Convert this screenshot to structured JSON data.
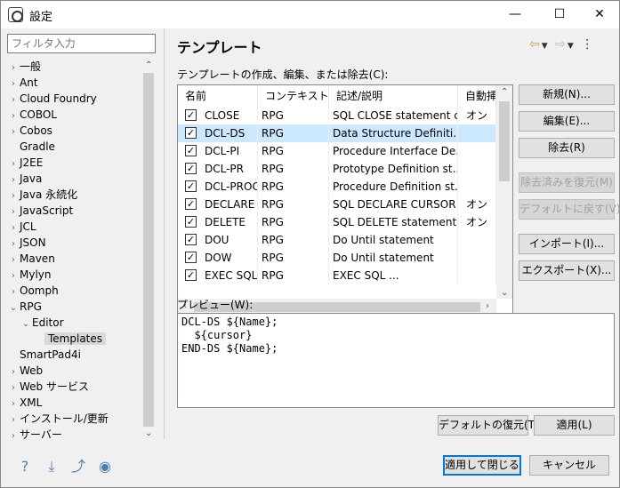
{
  "window": {
    "title": "設定",
    "minimize": "—",
    "maximize": "☐",
    "close": "✕"
  },
  "filter": {
    "placeholder": "フィルタ入力"
  },
  "tree": [
    {
      "label": "一般",
      "arrow": "›",
      "level": 0
    },
    {
      "label": "Ant",
      "arrow": "›",
      "level": 0
    },
    {
      "label": "Cloud Foundry",
      "arrow": "›",
      "level": 0
    },
    {
      "label": "COBOL",
      "arrow": "›",
      "level": 0
    },
    {
      "label": "Cobos",
      "arrow": "›",
      "level": 0
    },
    {
      "label": "Gradle",
      "arrow": "",
      "level": 0
    },
    {
      "label": "J2EE",
      "arrow": "›",
      "level": 0
    },
    {
      "label": "Java",
      "arrow": "›",
      "level": 0
    },
    {
      "label": "Java 永続化",
      "arrow": "›",
      "level": 0
    },
    {
      "label": "JavaScript",
      "arrow": "›",
      "level": 0
    },
    {
      "label": "JCL",
      "arrow": "›",
      "level": 0
    },
    {
      "label": "JSON",
      "arrow": "›",
      "level": 0
    },
    {
      "label": "Maven",
      "arrow": "›",
      "level": 0
    },
    {
      "label": "Mylyn",
      "arrow": "›",
      "level": 0
    },
    {
      "label": "Oomph",
      "arrow": "›",
      "level": 0
    },
    {
      "label": "RPG",
      "arrow": "⌄",
      "level": 0
    },
    {
      "label": "Editor",
      "arrow": "⌄",
      "level": 1
    },
    {
      "label": "Templates",
      "arrow": "",
      "level": 2,
      "selected": true
    },
    {
      "label": "SmartPad4i",
      "arrow": "",
      "level": 0
    },
    {
      "label": "Web",
      "arrow": "›",
      "level": 0
    },
    {
      "label": "Web サービス",
      "arrow": "›",
      "level": 0
    },
    {
      "label": "XML",
      "arrow": "›",
      "level": 0
    },
    {
      "label": "インストール/更新",
      "arrow": "›",
      "level": 0
    },
    {
      "label": "サーバー",
      "arrow": "›",
      "level": 0
    }
  ],
  "page": {
    "title": "テンプレート",
    "table_label": "テンプレートの作成、編集、または除去(C):",
    "preview_label": "プレビュー(W):",
    "columns": [
      "名前",
      "コンテキスト",
      "記述/説明",
      "自動挿"
    ],
    "rows": [
      {
        "name": "CLOSE",
        "context": "RPG",
        "desc": "SQL CLOSE statement c...",
        "auto": "オン",
        "checked": true
      },
      {
        "name": "DCL-DS",
        "context": "RPG",
        "desc": "Data Structure Definiti...",
        "auto": "",
        "checked": true,
        "selected": true
      },
      {
        "name": "DCL-PI",
        "context": "RPG",
        "desc": "Procedure Interface De...",
        "auto": "",
        "checked": true
      },
      {
        "name": "DCL-PR",
        "context": "RPG",
        "desc": "Prototype Definition st...",
        "auto": "",
        "checked": true
      },
      {
        "name": "DCL-PROC",
        "context": "RPG",
        "desc": "Procedure Definition st...",
        "auto": "",
        "checked": true
      },
      {
        "name": "DECLARE",
        "context": "RPG",
        "desc": "SQL DECLARE CURSOR ...",
        "auto": "オン",
        "checked": true
      },
      {
        "name": "DELETE",
        "context": "RPG",
        "desc": "SQL DELETE statement ...",
        "auto": "オン",
        "checked": true
      },
      {
        "name": "DOU",
        "context": "RPG",
        "desc": "Do Until statement",
        "auto": "",
        "checked": true
      },
      {
        "name": "DOW",
        "context": "RPG",
        "desc": "Do Until statement",
        "auto": "",
        "checked": true
      },
      {
        "name": "EXEC SQL",
        "context": "RPG",
        "desc": "EXEC SQL ...",
        "auto": "",
        "checked": true
      }
    ],
    "preview_text": "DCL-DS ${Name};\n  ${cursor}\nEND-DS ${Name};"
  },
  "buttons": {
    "new": "新規(N)...",
    "edit": "編集(E)...",
    "remove": "除去(R)",
    "restore_removed": "除去済みを復元(M)",
    "revert_default": "デフォルトに戻す(V)",
    "import": "インポート(I)...",
    "export": "エクスポート(X)...",
    "restore_defaults": "デフォルトの復元(T)",
    "apply": "適用(L)",
    "apply_close": "適用して閉じる",
    "cancel": "キャンセル"
  }
}
